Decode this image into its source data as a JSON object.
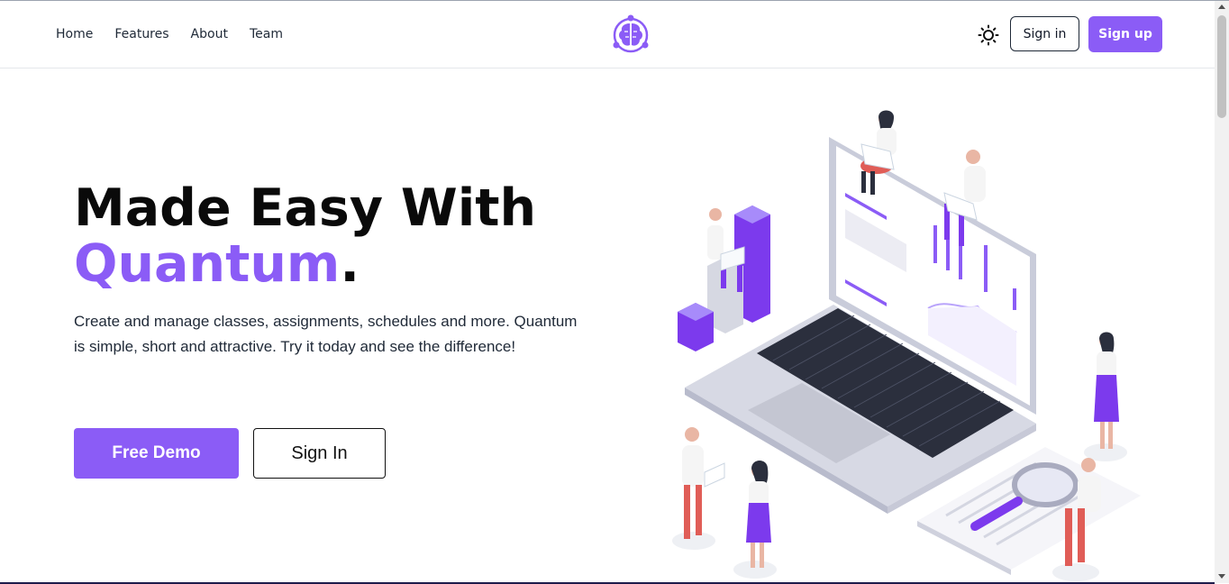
{
  "nav": {
    "links": [
      "Home",
      "Features",
      "About",
      "Team"
    ],
    "signin_label": "Sign in",
    "signup_label": "Sign up"
  },
  "hero": {
    "title_line1": "Made Easy With",
    "title_accent": "Quantum",
    "title_period": ".",
    "subtitle": "Create and manage classes, assignments, schedules and more. Quantum is simple, short and attractive. Try it today and see the difference!",
    "demo_label": "Free Demo",
    "signin_label": "Sign In"
  },
  "colors": {
    "accent": "#8b5cf6",
    "text_dark": "#0a0a0a"
  },
  "icons": {
    "logo": "brain-logo-icon",
    "theme_toggle": "sun-icon"
  }
}
